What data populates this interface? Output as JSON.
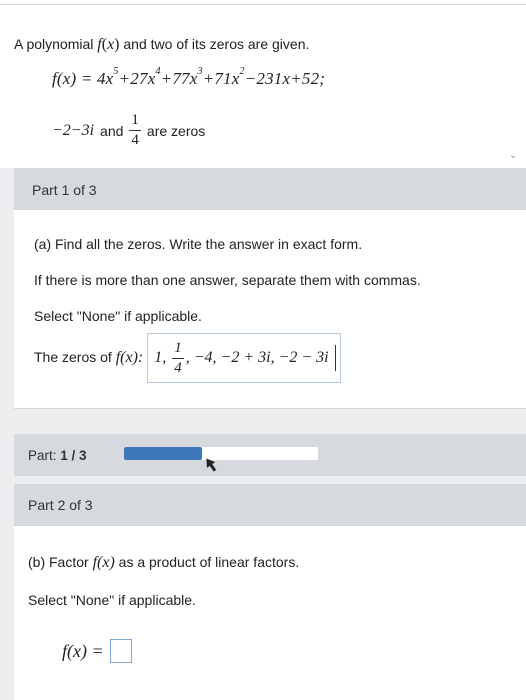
{
  "intro": {
    "text_prefix": "A polynomial",
    "fx": "f",
    "x": "x",
    "text_suffix": "and two of its zeros are given."
  },
  "polynomial": {
    "lhs": "f(x) = ",
    "t1_coef": "4x",
    "t1_exp": "5",
    "t2_coef": "+27x",
    "t2_exp": "4",
    "t3_coef": "+77x",
    "t3_exp": "3",
    "t4_coef": "+71x",
    "t4_exp": "2",
    "tail": "−231x+52;"
  },
  "given_zeros": {
    "zero1": "−2−3i",
    "and": "and",
    "zero2_num": "1",
    "zero2_den": "4",
    "suffix": "are zeros"
  },
  "part1": {
    "header": "Part 1 of 3",
    "instruction_a": "(a) Find all the zeros. Write the answer in exact form.",
    "instruction_b": "If there is more than one answer, separate them with commas.",
    "instruction_c": "Select \"None\" if applicable.",
    "answer_label_prefix": "The zeros of",
    "answer_label_fx": "f(x):",
    "answer_first": "1,",
    "answer_frac_num": "1",
    "answer_frac_den": "4",
    "answer_rest": ", −4, −2 + 3i, −2 − 3i"
  },
  "progress": {
    "label": "Part:",
    "value_text": "1 / 3",
    "fraction": 0.333,
    "fill_color": "#3f78b8"
  },
  "part2": {
    "header": "Part 2 of 3",
    "instruction_b": "(b) Factor",
    "instruction_fx": "f(x)",
    "instruction_suffix": "as a product of linear factors.",
    "instruction_none": "Select \"None\" if applicable.",
    "factor_lhs": "f(x) ="
  },
  "colors": {
    "accent": "#3f78b8",
    "header_bg": "#d6dade",
    "answer_border": "#b8c9dc"
  }
}
